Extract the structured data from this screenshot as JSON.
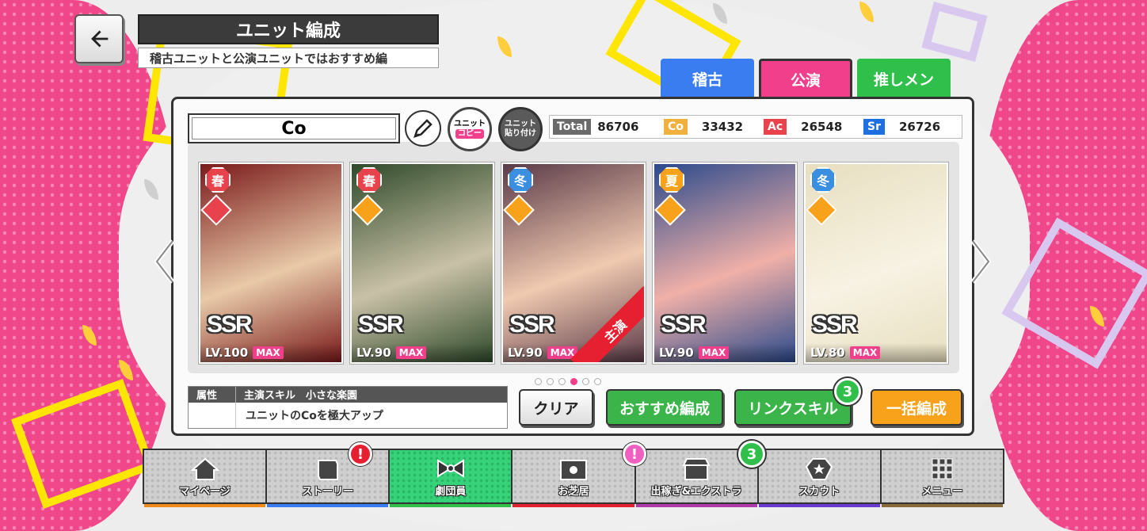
{
  "header": {
    "title": "ユニット編成",
    "subtitle": "稽古ユニットと公演ユニットではおすすめ編"
  },
  "tabs": [
    {
      "label": "稽古",
      "color": "#3a7df0",
      "active": false
    },
    {
      "label": "公演",
      "color": "#f13f8c",
      "active": true
    },
    {
      "label": "推しメン",
      "color": "#2fbf4a",
      "active": false
    }
  ],
  "unit": {
    "name": "Co",
    "copy_label_1": "ユニット",
    "copy_label_2": "コピー",
    "paste_label_1": "ユニット",
    "paste_label_2": "貼り付け"
  },
  "stats": {
    "total_label": "Total",
    "total": "86706",
    "co_label": "Co",
    "co": "33432",
    "ac_label": "Ac",
    "ac": "26548",
    "sr_label": "Sr",
    "sr": "26726"
  },
  "cards": [
    {
      "season": "春",
      "season_color": "#e8434d",
      "attr_color": "#e8434d",
      "rarity": "SSR",
      "level": "LV.100",
      "max": "MAX",
      "bg": [
        "#7a1a1a",
        "#e8c9a8"
      ]
    },
    {
      "season": "春",
      "season_color": "#e8434d",
      "attr_color": "#f7a21a",
      "rarity": "SSR",
      "level": "LV.90",
      "max": "MAX",
      "bg": [
        "#2f4a2a",
        "#c9c1a7"
      ]
    },
    {
      "season": "冬",
      "season_color": "#3a8fe0",
      "attr_color": "#f7a21a",
      "rarity": "SSR",
      "level": "LV.90",
      "max": "MAX",
      "bg": [
        "#5a3a48",
        "#f0c9b0"
      ],
      "lead": "主演"
    },
    {
      "season": "夏",
      "season_color": "#f7a21a",
      "attr_color": "#f7a21a",
      "rarity": "SSR",
      "level": "LV.90",
      "max": "MAX",
      "bg": [
        "#2b4a8c",
        "#f0b0a8"
      ]
    },
    {
      "season": "冬",
      "season_color": "#3a8fe0",
      "attr_color": "#f7a21a",
      "rarity": "SSR",
      "level": "LV.80",
      "max": "MAX",
      "bg": [
        "#e8dfc0",
        "#f7f2e3"
      ]
    }
  ],
  "pagination": {
    "count": 6,
    "active": 4
  },
  "skill": {
    "attr_header": "属性",
    "skill_header": "主演スキル　小さな楽園",
    "description": "ユニットのCoを極大アップ"
  },
  "actions": {
    "clear": "クリア",
    "recommend": "おすすめ編成",
    "link_skill": "リンクスキル",
    "link_count": "3",
    "bulk": "一括編成"
  },
  "nav": [
    {
      "label": "マイページ",
      "icon": "house-icon",
      "underline": "#f08a1a"
    },
    {
      "label": "ストーリー",
      "icon": "book-icon",
      "underline": "#3a7df0",
      "alert": "!",
      "alert_color": "#e62030"
    },
    {
      "label": "劇団員",
      "icon": "ribbon-icon",
      "underline": "#2fbf4a",
      "active": true
    },
    {
      "label": "お芝居",
      "icon": "stage-icon",
      "underline": "#e62030",
      "alert": "!",
      "alert_color": "#f15fc0"
    },
    {
      "label": "出稼ぎ&エクストラ",
      "icon": "shop-icon",
      "underline": "#b03aa8",
      "alert": "3",
      "alert_color": "#2fbf4a"
    },
    {
      "label": "スカウト",
      "icon": "badge-icon",
      "underline": "#6a3ad0"
    },
    {
      "label": "メニュー",
      "icon": "grid-icon",
      "underline": "#8a6a3a"
    }
  ]
}
